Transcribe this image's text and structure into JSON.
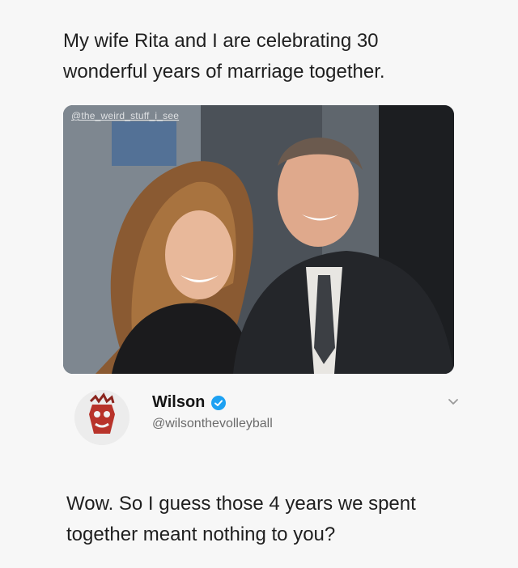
{
  "post": {
    "text": "My wife Rita and I are celebrating 30 wonderful years of marriage together."
  },
  "photo": {
    "watermark": "@the_weird_stuff_i_see"
  },
  "reply": {
    "display_name": "Wilson",
    "handle": "@wilsonthevolleyball",
    "text": "Wow. So I guess those 4 years we spent together meant nothing to you?",
    "verified_icon": "verified-badge-icon",
    "menu_icon": "chevron-down-icon",
    "verified_color": "#1da1f2"
  }
}
